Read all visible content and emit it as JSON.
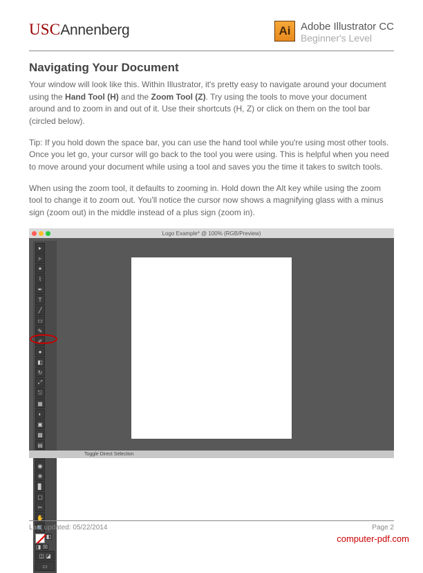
{
  "header": {
    "logo_usc": "USC",
    "logo_annenberg": "Annenberg",
    "app_icon_label": "Ai",
    "title": "Adobe Illustrator CC",
    "subtitle": "Beginner's Level"
  },
  "section": {
    "title": "Navigating Your Document",
    "para1_a": "Your window will look like this. Within Illustrator, it's pretty easy to navigate around your document using the ",
    "para1_b1": "Hand Tool (H)",
    "para1_c": " and the ",
    "para1_b2": "Zoom Tool (Z)",
    "para1_d": ". Try using the tools to move your document around and to zoom in and out of it. Use their shortcuts (H, Z) or click on them on the tool bar (circled below).",
    "para2": "Tip: If you hold down the space bar, you can use the hand tool while you're using most other tools. Once you let go, your cursor will go back to the tool you were using. This is helpful when you need to move around your document while using a tool and saves you the time it takes to switch tools.",
    "para3": "When using the zoom tool, it defaults to zooming in. Hold down the Alt key while using the zoom tool to change it to zoom out. You'll notice the cursor now shows a magnifying glass with a minus sign (zoom out) in the middle instead of a plus sign (zoom in)."
  },
  "screenshot": {
    "window_title": "Logo Example* @ 100% (RGB/Preview)",
    "status_text": "Toggle Direct Selection"
  },
  "footer": {
    "updated": "Last updated: 05/22/2014",
    "page": "Page  2"
  },
  "watermark": "computer-pdf.com"
}
